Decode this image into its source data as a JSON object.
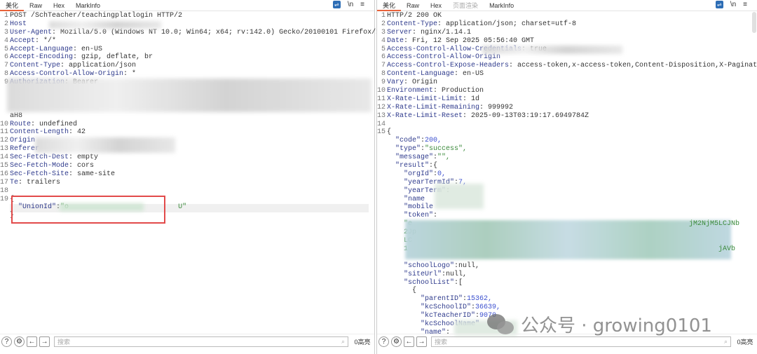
{
  "request": {
    "tabs": [
      "美化",
      "Raw",
      "Hex",
      "MarkInfo"
    ],
    "tools": {
      "wrap": "wrap-icon",
      "newline": "\\n",
      "menu": "≡"
    },
    "lines": [
      {
        "n": "1",
        "t": "plain",
        "v": "POST /SchTeacher/teachingplatlogin HTTP/2"
      },
      {
        "n": "2",
        "t": "h",
        "k": "Host",
        "v": ""
      },
      {
        "n": "3",
        "t": "h",
        "k": "User-Agent",
        "v": ": Mozilla/5.0 (Windows NT 10.0; Win64; x64; rv:142.0) Gecko/20100101 Firefox/142.0"
      },
      {
        "n": "4",
        "t": "h",
        "k": "Accept",
        "v": ": */*"
      },
      {
        "n": "5",
        "t": "h",
        "k": "Accept-Language",
        "v": ": en-US"
      },
      {
        "n": "6",
        "t": "h",
        "k": "Accept-Encoding",
        "v": ": gzip, deflate, br"
      },
      {
        "n": "7",
        "t": "h",
        "k": "Content-Type",
        "v": ": application/json"
      },
      {
        "n": "8",
        "t": "h",
        "k": "Access-Control-Allow-Origin",
        "v": ": *"
      },
      {
        "n": "9",
        "t": "h",
        "k": "Authorization",
        "v": ": Bearer"
      },
      {
        "n": "",
        "t": "plain",
        "v": ""
      },
      {
        "n": "",
        "t": "plain",
        "v": ""
      },
      {
        "n": "",
        "t": "plain",
        "v": ""
      },
      {
        "n": "",
        "t": "plain",
        "v": "aH8"
      },
      {
        "n": "10",
        "t": "h",
        "k": "Route",
        "v": ": undefined"
      },
      {
        "n": "11",
        "t": "h",
        "k": "Content-Length",
        "v": ": 42"
      },
      {
        "n": "12",
        "t": "h",
        "k": "Origin",
        "v": ""
      },
      {
        "n": "13",
        "t": "h",
        "k": "Referer",
        "v": ""
      },
      {
        "n": "14",
        "t": "h",
        "k": "Sec-Fetch-Dest",
        "v": ": empty"
      },
      {
        "n": "15",
        "t": "h",
        "k": "Sec-Fetch-Mode",
        "v": ": cors"
      },
      {
        "n": "16",
        "t": "h",
        "k": "Sec-Fetch-Site",
        "v": ": same-site"
      },
      {
        "n": "17",
        "t": "h",
        "k": "Te",
        "v": ": trailers"
      },
      {
        "n": "18",
        "t": "plain",
        "v": ""
      },
      {
        "n": "19",
        "t": "plain",
        "v": "{"
      },
      {
        "n": "",
        "t": "j",
        "i": "  ",
        "k": "\"UnionId\"",
        "s": ":",
        "v": "\"o                          U\"",
        "vt": "js"
      },
      {
        "n": "",
        "t": "plain",
        "v": "}"
      }
    ],
    "search_placeholder": "搜索",
    "hits": "0高亮"
  },
  "response": {
    "tabs": [
      "美化",
      "Raw",
      "Hex",
      "页面渲染",
      "MarkInfo"
    ],
    "lines": [
      {
        "n": "1",
        "t": "plain",
        "v": "HTTP/2 200 OK"
      },
      {
        "n": "2",
        "t": "h",
        "k": "Content-Type",
        "v": ": application/json; charset=utf-8"
      },
      {
        "n": "3",
        "t": "h",
        "k": "Server",
        "v": ": nginx/1.14.1"
      },
      {
        "n": "4",
        "t": "h",
        "k": "Date",
        "v": ": Fri, 12 Sep 2025 05:56:40 GMT"
      },
      {
        "n": "5",
        "t": "h",
        "k": "Access-Control-Allow-Credentials",
        "v": ": true"
      },
      {
        "n": "6",
        "t": "h",
        "k": "Access-Control-Allow-Origin",
        "v": ""
      },
      {
        "n": "7",
        "t": "h",
        "k": "Access-Control-Expose-Headers",
        "v": ": access-token,x-access-token,Content-Disposition,X-Pagination"
      },
      {
        "n": "8",
        "t": "h",
        "k": "Content-Language",
        "v": ": en-US"
      },
      {
        "n": "9",
        "t": "h",
        "k": "Vary",
        "v": ": Origin"
      },
      {
        "n": "10",
        "t": "h",
        "k": "Environment",
        "v": ": Production"
      },
      {
        "n": "11",
        "t": "h",
        "k": "X-Rate-Limit-Limit",
        "v": ": 1d"
      },
      {
        "n": "12",
        "t": "h",
        "k": "X-Rate-Limit-Remaining",
        "v": ": 999992"
      },
      {
        "n": "13",
        "t": "h",
        "k": "X-Rate-Limit-Reset",
        "v": ": 2025-09-13T03:19:17.6949784Z"
      },
      {
        "n": "14",
        "t": "plain",
        "v": ""
      },
      {
        "n": "15",
        "t": "plain",
        "v": "{"
      },
      {
        "n": "",
        "t": "j",
        "i": "  ",
        "k": "\"code\"",
        "s": ":",
        "v": "200,",
        "vt": "jn"
      },
      {
        "n": "",
        "t": "j",
        "i": "  ",
        "k": "\"type\"",
        "s": ":",
        "v": "\"success\",",
        "vt": "js"
      },
      {
        "n": "",
        "t": "j",
        "i": "  ",
        "k": "\"message\"",
        "s": ":",
        "v": "\"\",",
        "vt": "js"
      },
      {
        "n": "",
        "t": "j",
        "i": "  ",
        "k": "\"result\"",
        "s": ":{",
        "v": "",
        "vt": "hv"
      },
      {
        "n": "",
        "t": "j",
        "i": "    ",
        "k": "\"orgId\"",
        "s": ":",
        "v": "0,",
        "vt": "jn"
      },
      {
        "n": "",
        "t": "j",
        "i": "    ",
        "k": "\"yearTermId\"",
        "s": ":",
        "v": "7,",
        "vt": "jn"
      },
      {
        "n": "",
        "t": "j",
        "i": "    ",
        "k": "\"yearTerm\"",
        "s": ":",
        "v": "",
        "vt": "js"
      },
      {
        "n": "",
        "t": "j",
        "i": "    ",
        "k": "\"name",
        "s": "",
        "v": "",
        "vt": "js"
      },
      {
        "n": "",
        "t": "j",
        "i": "    ",
        "k": "\"mobile",
        "s": "",
        "v": "",
        "vt": "js"
      },
      {
        "n": "",
        "t": "j",
        "i": "    ",
        "k": "\"token\"",
        "s": ":",
        "v": "",
        "vt": "js"
      },
      {
        "n": "",
        "t": "j",
        "i": "    ",
        "k": "",
        "s": "",
        "v": "\"e",
        "vt": "js"
      },
      {
        "n": "",
        "t": "j",
        "i": "    ",
        "k": "",
        "s": "",
        "v": "2Jp",
        "vt": "js"
      },
      {
        "n": "",
        "t": "j",
        "i": "    ",
        "k": "",
        "s": "",
        "v": "LC",
        "vt": "js"
      },
      {
        "n": "",
        "t": "j",
        "i": "    ",
        "k": "",
        "s": "",
        "v": "1",
        "vt": "js"
      },
      {
        "n": "",
        "t": "plain",
        "v": ""
      },
      {
        "n": "",
        "t": "j",
        "i": "    ",
        "k": "\"schoolLogo\"",
        "s": ":",
        "v": "null,",
        "vt": "hv"
      },
      {
        "n": "",
        "t": "j",
        "i": "    ",
        "k": "\"siteUrl\"",
        "s": ":",
        "v": "null,",
        "vt": "hv"
      },
      {
        "n": "",
        "t": "j",
        "i": "    ",
        "k": "\"schoolList\"",
        "s": ":[",
        "v": "",
        "vt": "hv"
      },
      {
        "n": "",
        "t": "plain",
        "v": "      {"
      },
      {
        "n": "",
        "t": "j",
        "i": "        ",
        "k": "\"parentID\"",
        "s": ":",
        "v": "15362,",
        "vt": "jn"
      },
      {
        "n": "",
        "t": "j",
        "i": "        ",
        "k": "\"kcSchoolID\"",
        "s": ":",
        "v": "36639,",
        "vt": "jn"
      },
      {
        "n": "",
        "t": "j",
        "i": "        ",
        "k": "\"kcTeacherID\"",
        "s": ":",
        "v": "9070",
        "vt": "jn"
      },
      {
        "n": "",
        "t": "j",
        "i": "        ",
        "k": "\"kcSchoolName\"",
        "s": "",
        "v": "",
        "vt": "js"
      },
      {
        "n": "",
        "t": "j",
        "i": "        ",
        "k": "\"name\"",
        "s": ":",
        "v": "",
        "vt": "js"
      }
    ],
    "token_visible_right_1": "jM2NjM5LCJNb",
    "token_visible_right_2": "jAVb",
    "search_placeholder": "搜索",
    "hits": "0高亮"
  },
  "watermark": "公众号 · growing0101"
}
